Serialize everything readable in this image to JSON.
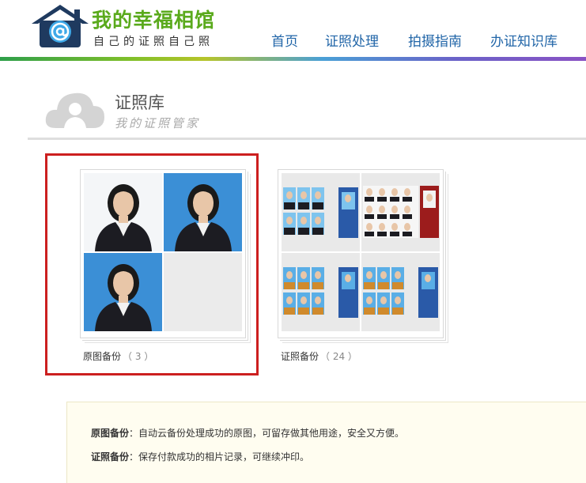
{
  "header": {
    "brand_title": "我的幸福相馆",
    "brand_slogan": "自己的证照自己照",
    "nav": [
      "首页",
      "证照处理",
      "拍摄指南",
      "办证知识库"
    ]
  },
  "page": {
    "title": "证照库",
    "subtitle": "我的证照管家"
  },
  "albums": [
    {
      "name": "原图备份",
      "count": "（ 3 ）"
    },
    {
      "name": "证照备份",
      "count": "（ 24 ）"
    }
  ],
  "notice": {
    "line1_key": "原图备份",
    "line1_text": "：自动云备份处理成功的原图，可留存做其他用途，安全又方便。",
    "line2_key": "证照备份",
    "line2_text": "：保存付款成功的相片记录，可继续冲印。"
  },
  "colors": {
    "brand_green": "#5aaa1c",
    "nav_blue": "#2266a8",
    "selection_red": "#cc1f1f",
    "notice_bg": "#fffdf0",
    "logo_navy": "#1f3a5f",
    "photo_blue": "#3b8fd6"
  },
  "icons": {
    "logo": "house-at-icon",
    "title": "cloud-user-icon"
  }
}
